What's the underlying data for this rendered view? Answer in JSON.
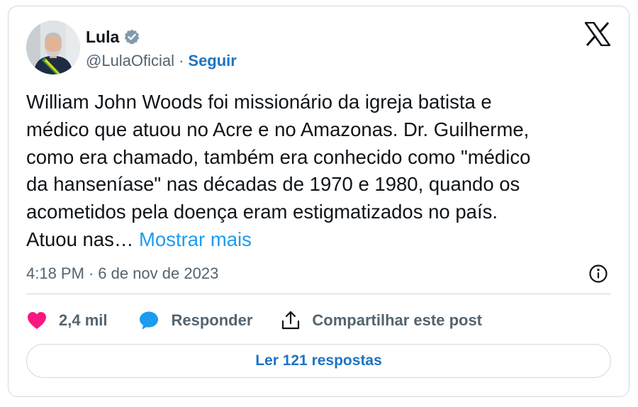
{
  "author": {
    "name": "Lula",
    "handle": "@LulaOficial",
    "separator": "·",
    "follow_label": "Seguir",
    "verified_badge_color": "#829aab"
  },
  "post": {
    "lines": [
      "William John Woods foi missionário da igreja batista e",
      "médico que atuou no Acre e no Amazonas. Dr. Guilherme,",
      "como era chamado, também era conhecido como \"médico",
      "da hanseníase\" nas décadas de 1970 e 1980, quando os",
      "acometidos pela doença eram estigmatizados no país.",
      "Atuou nas…"
    ],
    "show_more_label": "Mostrar mais",
    "time": "4:18 PM",
    "separator": "·",
    "date": "6 de nov de 2023"
  },
  "actions": {
    "like_count": "2,4 mil",
    "reply_label": "Responder",
    "share_label": "Compartilhar este post"
  },
  "replies_button_label": "Ler 121 respostas",
  "icons": {
    "logo": "x-logo-icon",
    "verified": "verified-badge-icon",
    "info": "info-icon",
    "like": "heart-icon",
    "reply": "speech-bubble-icon",
    "share": "share-icon"
  },
  "colors": {
    "link": "#1d74c4",
    "show_more": "#1d9bf0",
    "heart": "#f91880",
    "reply_bubble": "#1d9bf0",
    "secondary_text": "#536471",
    "border": "#cfd9de"
  }
}
